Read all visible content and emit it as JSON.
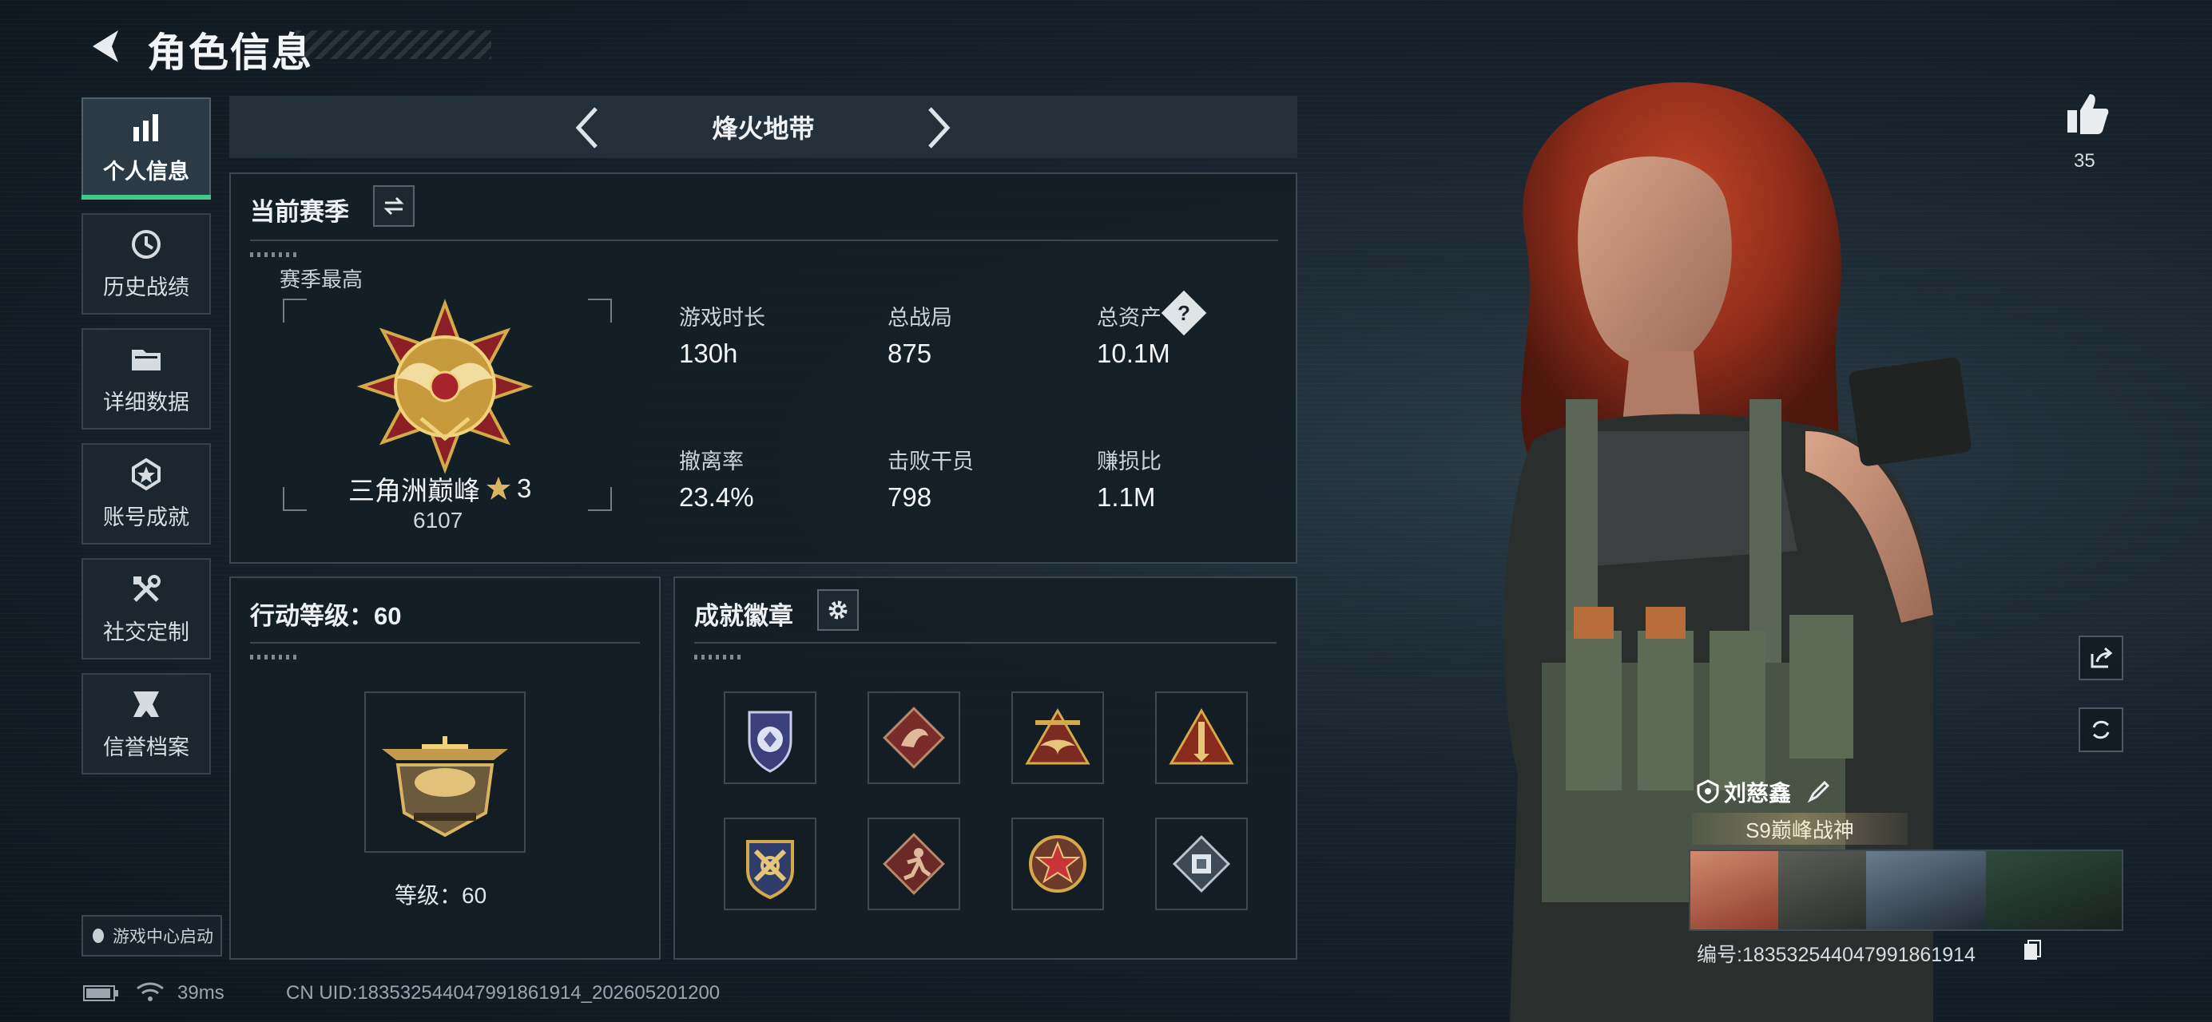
{
  "header": {
    "title": "角色信息"
  },
  "sidebar": {
    "items": [
      {
        "label": "个人信息",
        "icon": "bar-chart-icon",
        "active": true
      },
      {
        "label": "历史战绩",
        "icon": "history-clock-icon",
        "active": false
      },
      {
        "label": "详细数据",
        "icon": "folder-icon",
        "active": false
      },
      {
        "label": "账号成就",
        "icon": "achievement-icon",
        "active": false
      },
      {
        "label": "社交定制",
        "icon": "tools-icon",
        "active": false
      },
      {
        "label": "信誉档案",
        "icon": "credit-shield-icon",
        "active": false
      }
    ],
    "launch_label": "游戏中心启动"
  },
  "mode_selector": {
    "label": "烽火地带"
  },
  "season": {
    "title": "当前赛季",
    "peak_label": "赛季最高",
    "rank_name": "三角洲巅峰",
    "rank_stars": "3",
    "rank_score": "6107",
    "stats": [
      {
        "label": "游戏时长",
        "value": "130h"
      },
      {
        "label": "总战局",
        "value": "875"
      },
      {
        "label": "总资产",
        "value": "10.1M",
        "has_help": true
      },
      {
        "label": "撤离率",
        "value": "23.4%"
      },
      {
        "label": "击败干员",
        "value": "798"
      },
      {
        "label": "赚损比",
        "value": "1.1M"
      }
    ],
    "help_symbol": "?"
  },
  "action_level": {
    "title": "行动等级：60",
    "level_text": "等级：60"
  },
  "achievements": {
    "title": "成就徽章",
    "badges": [
      "shield-star-badge-icon",
      "dragon-badge-icon",
      "triangle-bird-badge-icon",
      "triangle-rocket-badge-icon",
      "crossed-weapon-badge-icon",
      "runner-badge-icon",
      "red-star-badge-icon",
      "diamond-chip-badge-icon"
    ]
  },
  "status_bar": {
    "ping": "39ms",
    "uid": "CN UID:18353254404799186191​4_202605201200"
  },
  "player": {
    "likes": "35",
    "name": "刘慈鑫",
    "title": "S9巅峰战神",
    "id_text": "编号:18353254404799186191​4"
  },
  "colors": {
    "accent": "#3ec98a",
    "gold": "#d4a94a",
    "panel_border": "#3a4852"
  }
}
